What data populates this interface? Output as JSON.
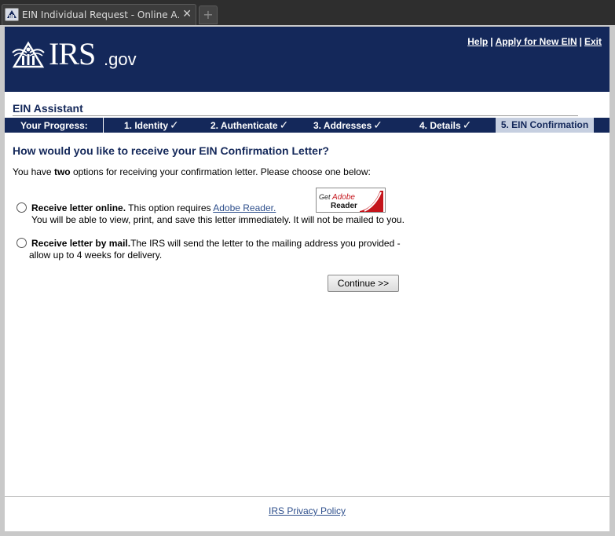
{
  "browser": {
    "tab_title": "EIN Individual Request - Online A…",
    "close_glyph": "✕",
    "new_tab_glyph": "+"
  },
  "header": {
    "logo_irs": "IRS",
    "logo_gov": ".gov",
    "links": {
      "help": "Help",
      "apply": "Apply for New EIN",
      "exit": "Exit",
      "separator": "|"
    }
  },
  "assistant": {
    "title": "EIN Assistant"
  },
  "progress": {
    "label": "Your Progress:",
    "steps": [
      {
        "label": "1. Identity",
        "completed": true
      },
      {
        "label": "2. Authenticate",
        "completed": true
      },
      {
        "label": "3. Addresses",
        "completed": true
      },
      {
        "label": "4. Details",
        "completed": true
      },
      {
        "label": "5. EIN Confirmation",
        "completed": false,
        "current": true
      }
    ],
    "check_glyph": "✓"
  },
  "content": {
    "question": "How would you like to receive your EIN Confirmation Letter?",
    "intro_before": "You have ",
    "intro_bold": "two",
    "intro_after": " options for receiving your confirmation letter. Please choose one below:",
    "option_online": {
      "bold": "Receive letter online.",
      "text": " This option requires ",
      "link": "Adobe Reader.",
      "line2": "You will be able to view, print, and save this letter immediately. It will not be mailed to you.",
      "selected": false
    },
    "option_mail": {
      "bold": "Receive letter by mail.",
      "text": "The IRS will send the letter to the mailing address you provided -",
      "line2": "allow up to 4 weeks for delivery.",
      "selected": false
    },
    "adobe_badge": {
      "get": "Get",
      "adobe": "Adobe",
      "reader": "Reader"
    },
    "continue_button": "Continue >>"
  },
  "footer": {
    "privacy_link": "IRS Privacy Policy"
  },
  "colors": {
    "irs_navy": "#14285a",
    "current_step_bg": "#c6cfe0",
    "link_blue": "#2e4f8c",
    "adobe_red": "#c4141b"
  }
}
